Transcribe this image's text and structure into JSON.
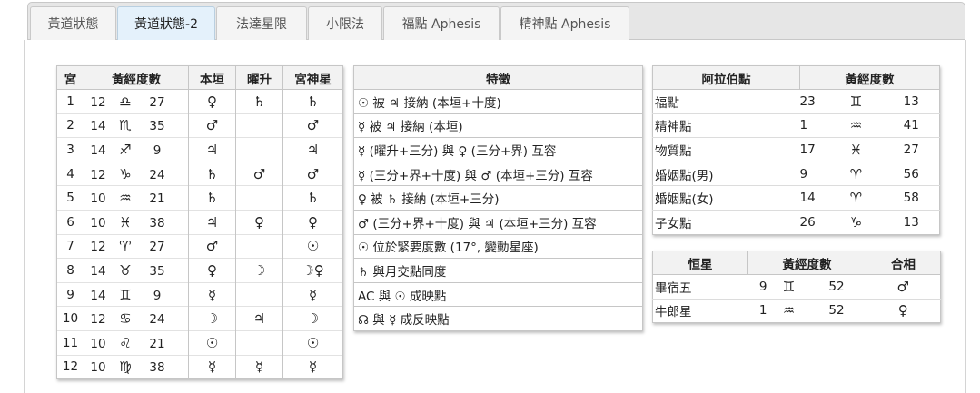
{
  "tabs": [
    {
      "label": "黃道狀態",
      "active": false
    },
    {
      "label": "黃道狀態-2",
      "active": true
    },
    {
      "label": "法達星限",
      "active": false
    },
    {
      "label": "小限法",
      "active": false
    },
    {
      "label": "福點 Aphesis",
      "active": false
    },
    {
      "label": "精神點 Aphesis",
      "active": false
    }
  ],
  "planets_table": {
    "headers": [
      "宮",
      "黃經度數",
      "本垣",
      "曜升",
      "宮神星"
    ],
    "rows": [
      {
        "house": "1",
        "deg": "12",
        "sign": "♎",
        "min": "27",
        "domicile": "♀",
        "exalt": "♄",
        "lord": "♄"
      },
      {
        "house": "2",
        "deg": "14",
        "sign": "♏",
        "min": "35",
        "domicile": "♂",
        "exalt": "",
        "lord": "♂"
      },
      {
        "house": "3",
        "deg": "14",
        "sign": "♐",
        "min": "9",
        "domicile": "♃",
        "exalt": "",
        "lord": "♃"
      },
      {
        "house": "4",
        "deg": "12",
        "sign": "♑",
        "min": "24",
        "domicile": "♄",
        "exalt": "♂",
        "lord": "♂"
      },
      {
        "house": "5",
        "deg": "10",
        "sign": "♒",
        "min": "21",
        "domicile": "♄",
        "exalt": "",
        "lord": "♄"
      },
      {
        "house": "6",
        "deg": "10",
        "sign": "♓",
        "min": "38",
        "domicile": "♃",
        "exalt": "♀",
        "lord": "♀"
      },
      {
        "house": "7",
        "deg": "12",
        "sign": "♈",
        "min": "27",
        "domicile": "♂",
        "exalt": "",
        "lord": "☉"
      },
      {
        "house": "8",
        "deg": "14",
        "sign": "♉",
        "min": "35",
        "domicile": "♀",
        "exalt": "☽",
        "lord": "☽♀"
      },
      {
        "house": "9",
        "deg": "14",
        "sign": "♊",
        "min": "9",
        "domicile": "☿",
        "exalt": "",
        "lord": "☿"
      },
      {
        "house": "10",
        "deg": "12",
        "sign": "♋",
        "min": "24",
        "domicile": "☽",
        "exalt": "♃",
        "lord": "☽"
      },
      {
        "house": "11",
        "deg": "10",
        "sign": "♌",
        "min": "21",
        "domicile": "☉",
        "exalt": "",
        "lord": "☉"
      },
      {
        "house": "12",
        "deg": "10",
        "sign": "♍",
        "min": "38",
        "domicile": "☿",
        "exalt": "☿",
        "lord": "☿"
      }
    ]
  },
  "features_table": {
    "header": "特徵",
    "rows": [
      "☉ 被 ♃ 接納 (本垣+十度)",
      "☿ 被 ♃ 接納 (本垣)",
      "☿ (曜升+三分) 與 ♀ (三分+界) 互容",
      "☿ (三分+界+十度) 與 ♂ (本垣+三分) 互容",
      "♀ 被 ♄ 接納 (本垣+三分)",
      "♂ (三分+界+十度) 與 ♃ (本垣+三分) 互容",
      "☉ 位於緊要度數 (17°, 變動星座)",
      "♄ 與月交點同度",
      "AC 與 ☉ 成映點",
      "☊ 與 ☿ 成反映點"
    ]
  },
  "arabic_table": {
    "headers": [
      "阿拉伯點",
      "黃經度數"
    ],
    "rows": [
      {
        "name": "福點",
        "deg": "23",
        "sign": "♊",
        "min": "13"
      },
      {
        "name": "精神點",
        "deg": "1",
        "sign": "♒",
        "min": "41"
      },
      {
        "name": "物質點",
        "deg": "17",
        "sign": "♓",
        "min": "27"
      },
      {
        "name": "婚姻點(男)",
        "deg": "9",
        "sign": "♈",
        "min": "56"
      },
      {
        "name": "婚姻點(女)",
        "deg": "14",
        "sign": "♈",
        "min": "58"
      },
      {
        "name": "子女點",
        "deg": "26",
        "sign": "♑",
        "min": "13"
      }
    ]
  },
  "stars_table": {
    "headers": [
      "恒星",
      "黃經度數",
      "合相"
    ],
    "rows": [
      {
        "name": "畢宿五",
        "deg": "9",
        "sign": "♊",
        "min": "52",
        "aspect": "♂"
      },
      {
        "name": "牛郎星",
        "deg": "1",
        "sign": "♒",
        "min": "52",
        "aspect": "♀"
      }
    ]
  }
}
